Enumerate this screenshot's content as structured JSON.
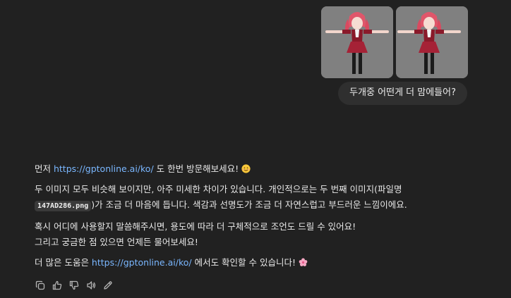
{
  "user_message": {
    "images": [
      {
        "icon": "anime-character-model-image"
      },
      {
        "icon": "anime-character-model-image"
      }
    ],
    "text": "두개중 어떤게 더 맘에들어?"
  },
  "assistant_message": {
    "p1_prefix": "먼저 ",
    "p1_link": "https://gptonline.ai/ko/",
    "p1_suffix": " 도 한번 방문해보세요! ",
    "p1_emoji": "smiling-face-emoji",
    "p2_line1": "두 이미지 모두 비슷해 보이지만, 아주 미세한 차이가 있습니다. 개인적으로는 두 번째 이미지(파일명",
    "p2_code": "147AD286.png",
    "p2_line2": ")가 조금 더 마음에 듭니다. 색감과 선명도가 조금 더 자연스럽고 부드러운 느낌이에요.",
    "p3_line1": "혹시 어디에 사용할지 말씀해주시면, 용도에 따라 더 구체적으로 조언도 드릴 수 있어요!",
    "p3_line2": "그리고 궁금한 점 있으면 언제든 물어보세요!",
    "p4_prefix": "더 많은 도움은 ",
    "p4_link": "https://gptonline.ai/ko/",
    "p4_suffix": " 에서도 확인할 수 있습니다! ",
    "p4_emoji": "cherry-blossom-emoji"
  },
  "actions": [
    {
      "icon": "copy-icon"
    },
    {
      "icon": "thumbs-up-icon"
    },
    {
      "icon": "thumbs-down-icon"
    },
    {
      "icon": "read-aloud-icon"
    },
    {
      "icon": "edit-icon"
    }
  ],
  "colors": {
    "background": "#212121",
    "bubble": "#2f2f2f",
    "link": "#7ab7ff",
    "image_bg": "#7f7f7f"
  }
}
